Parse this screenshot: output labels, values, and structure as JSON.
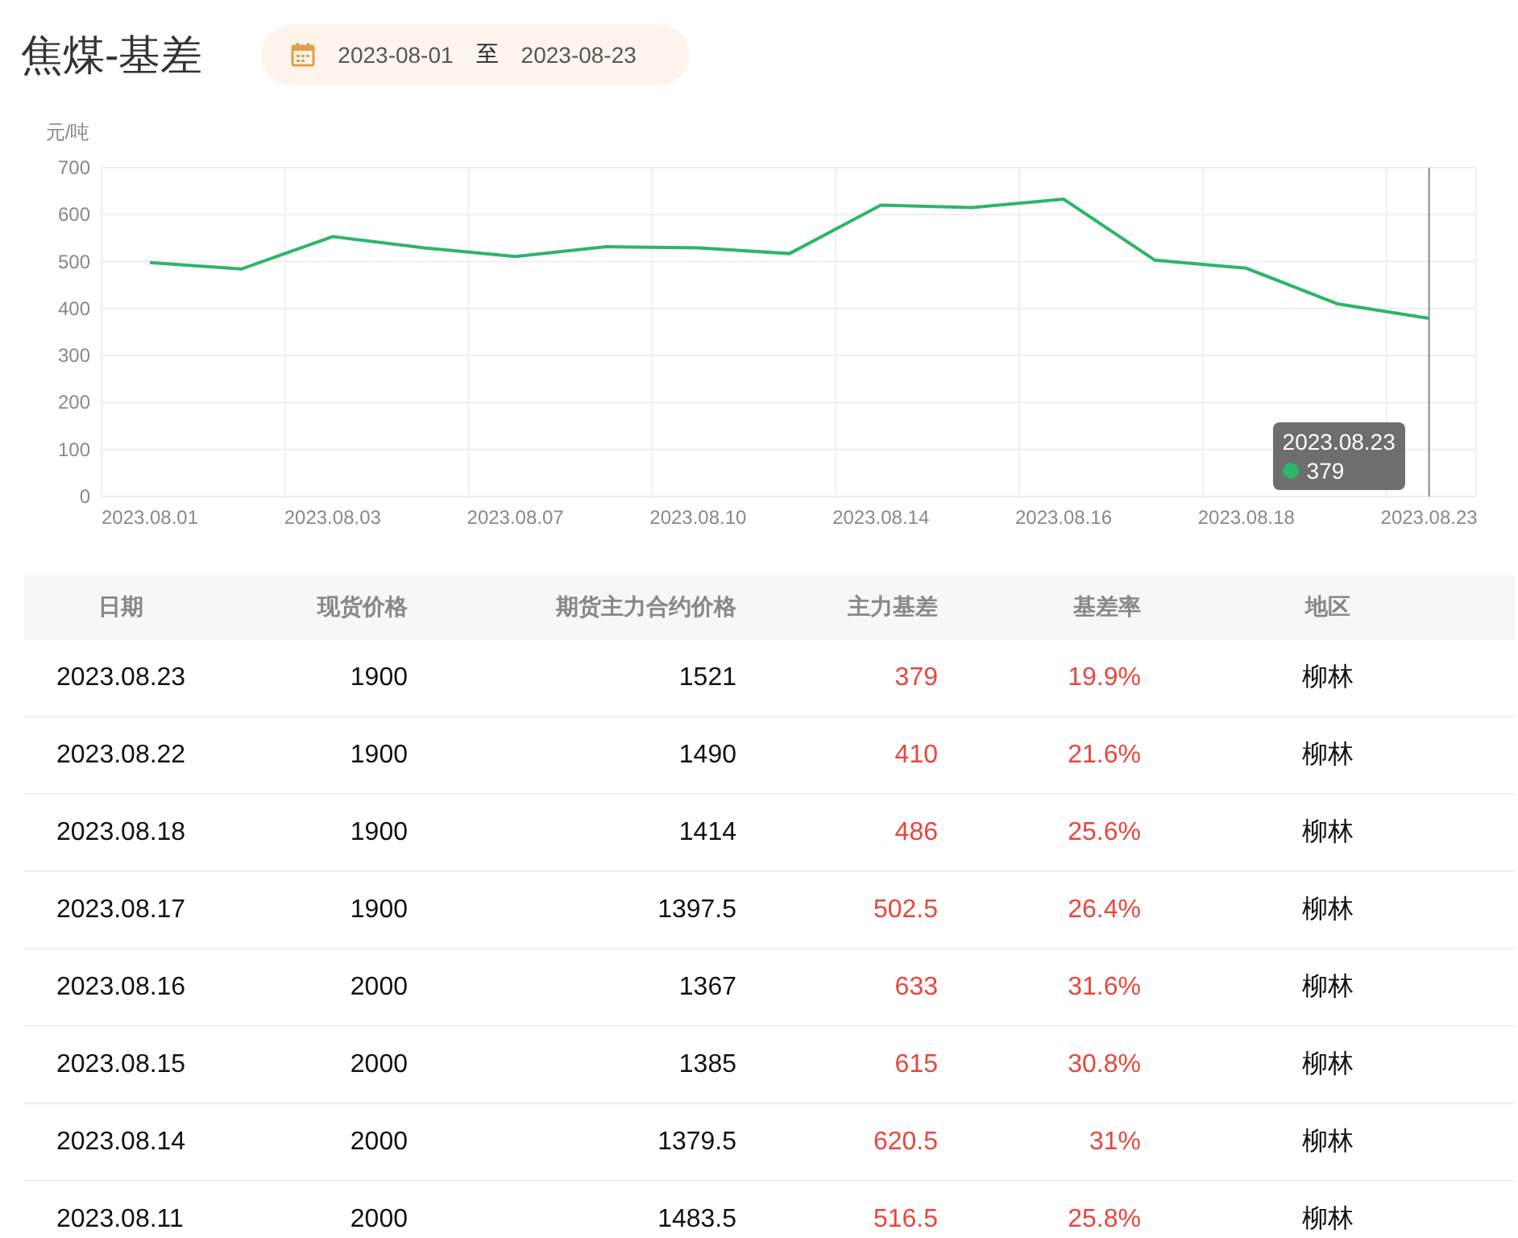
{
  "title": "焦煤-基差",
  "date_range": {
    "start": "2023-08-01",
    "separator": "至",
    "end": "2023-08-23"
  },
  "chart": {
    "chart_data": {
      "type": "line",
      "ylabel": "元/吨",
      "categories": [
        "2023.08.01",
        null,
        "2023.08.03",
        null,
        "2023.08.07",
        null,
        "2023.08.10",
        null,
        "2023.08.14",
        null,
        "2023.08.16",
        null,
        "2023.08.18",
        null,
        "2023.08.23"
      ],
      "series": [
        {
          "color": "#2db56a",
          "values": [
            498,
            484,
            553,
            529,
            511,
            532,
            529,
            517,
            620,
            615,
            633,
            503,
            486,
            410,
            379
          ]
        }
      ],
      "ylim": [
        0,
        700
      ],
      "yticks": [
        0,
        100,
        200,
        300,
        400,
        500,
        600,
        700
      ],
      "grid": true,
      "ref_lines": [
        {
          "axis": "x",
          "value": "2023.08.23",
          "color": "#888888"
        }
      ]
    },
    "tooltip": {
      "label": "2023.08.23",
      "value": "379"
    }
  },
  "table": {
    "columns": [
      {
        "label": "日期",
        "highlight": false
      },
      {
        "label": "现货价格",
        "highlight": false
      },
      {
        "label": "期货主力合约价格",
        "highlight": false
      },
      {
        "label": "主力基差",
        "highlight": true
      },
      {
        "label": "基差率",
        "highlight": true
      },
      {
        "label": "地区",
        "highlight": false
      }
    ],
    "rows": [
      [
        "2023.08.23",
        "1900",
        "1521",
        "379",
        "19.9%",
        "柳林"
      ],
      [
        "2023.08.22",
        "1900",
        "1490",
        "410",
        "21.6%",
        "柳林"
      ],
      [
        "2023.08.18",
        "1900",
        "1414",
        "486",
        "25.6%",
        "柳林"
      ],
      [
        "2023.08.17",
        "1900",
        "1397.5",
        "502.5",
        "26.4%",
        "柳林"
      ],
      [
        "2023.08.16",
        "2000",
        "1367",
        "633",
        "31.6%",
        "柳林"
      ],
      [
        "2023.08.15",
        "2000",
        "1385",
        "615",
        "30.8%",
        "柳林"
      ],
      [
        "2023.08.14",
        "2000",
        "1379.5",
        "620.5",
        "31%",
        "柳林"
      ],
      [
        "2023.08.11",
        "2000",
        "1483.5",
        "516.5",
        "25.8%",
        "柳林"
      ]
    ]
  }
}
